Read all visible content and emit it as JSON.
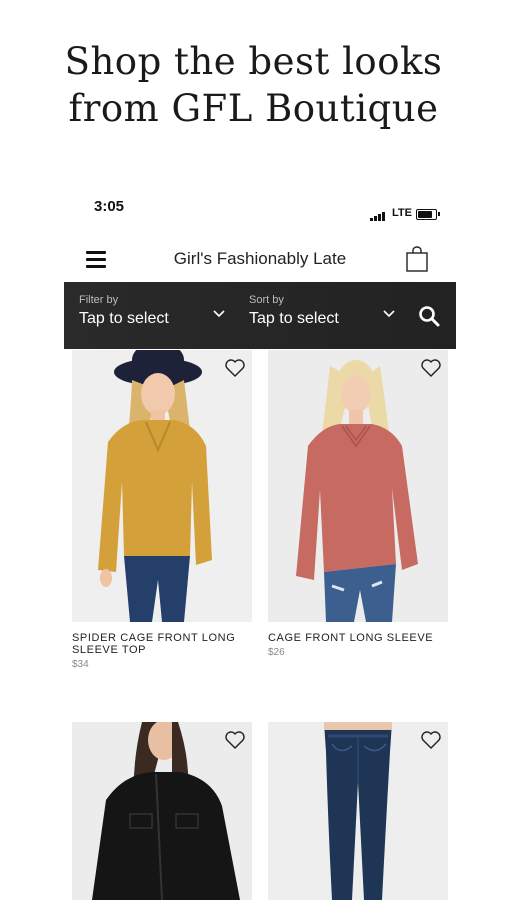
{
  "promo": {
    "line1": "Shop the best looks",
    "line2": "from GFL Boutique"
  },
  "status": {
    "time": "3:05",
    "network": "LTE"
  },
  "header": {
    "title": "Girl's Fashionably Late",
    "menu_icon": "hamburger-menu-icon",
    "cart_icon": "shopping-bag-icon"
  },
  "filter": {
    "label": "Filter by",
    "value": "Tap to select"
  },
  "sort": {
    "label": "Sort by",
    "value": "Tap to select"
  },
  "products": [
    {
      "name": "SPIDER CAGE FRONT LONG SLEEVE TOP",
      "price": "$34"
    },
    {
      "name": "CAGE FRONT LONG SLEEVE",
      "price": "$26"
    },
    {
      "name": "",
      "price": ""
    },
    {
      "name": "",
      "price": ""
    }
  ],
  "colors": {
    "bar": "#242424",
    "text": "#222222",
    "price": "#888888"
  }
}
